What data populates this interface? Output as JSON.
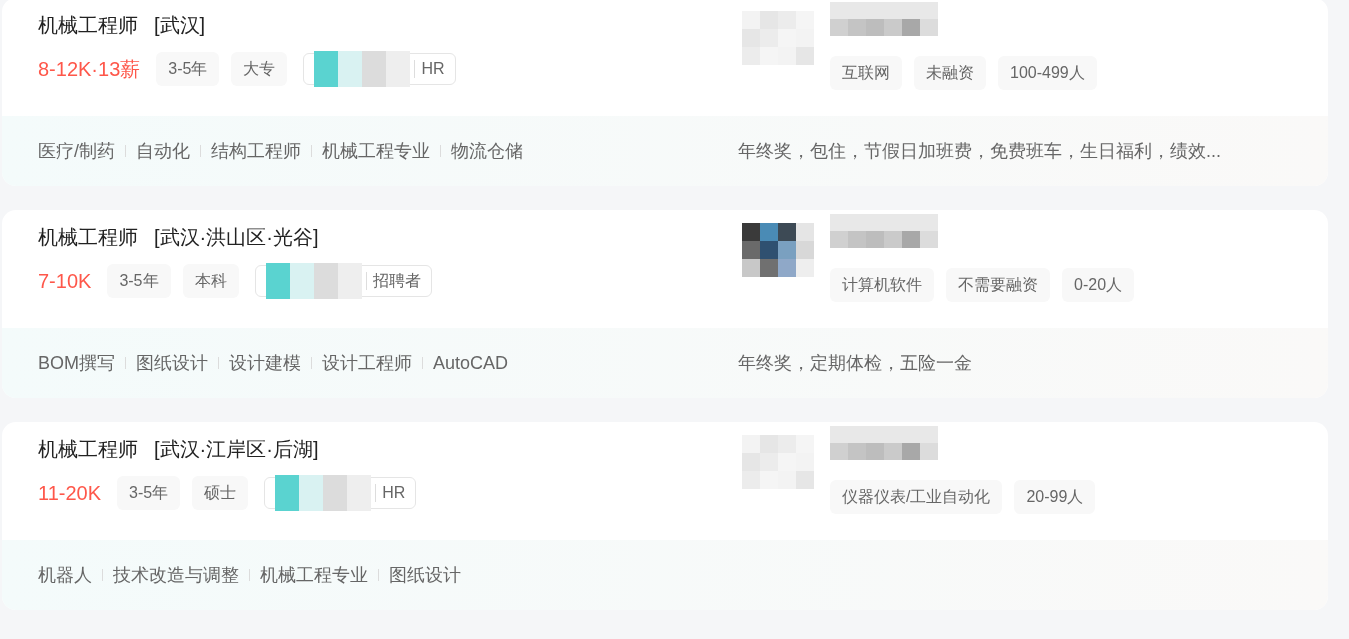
{
  "jobs": [
    {
      "title": "机械工程师",
      "location": "[武汉]",
      "salary": "8-12K·13薪",
      "tags": [
        "3-5年",
        "大专"
      ],
      "recruiter_role": "HR",
      "skills": [
        "医疗/制药",
        "自动化",
        "结构工程师",
        "机械工程专业",
        "物流仓储"
      ],
      "company_tags": [
        "互联网",
        "未融资",
        "100-499人"
      ],
      "benefits": "年终奖，包住，节假日加班费，免费班车，生日福利，绩效..."
    },
    {
      "title": "机械工程师",
      "location": "[武汉·洪山区·光谷]",
      "salary": "7-10K",
      "tags": [
        "3-5年",
        "本科"
      ],
      "recruiter_role": "招聘者",
      "skills": [
        "BOM撰写",
        "图纸设计",
        "设计建模",
        "设计工程师",
        "AutoCAD"
      ],
      "company_tags": [
        "计算机软件",
        "不需要融资",
        "0-20人"
      ],
      "benefits": "年终奖，定期体检，五险一金"
    },
    {
      "title": "机械工程师",
      "location": "[武汉·江岸区·后湖]",
      "salary": "11-20K",
      "tags": [
        "3-5年",
        "硕士"
      ],
      "recruiter_role": "HR",
      "skills": [
        "机器人",
        "技术改造与调整",
        "机械工程专业",
        "图纸设计"
      ],
      "company_tags": [
        "仪器仪表/工业自动化",
        "20-99人"
      ]
    }
  ]
}
